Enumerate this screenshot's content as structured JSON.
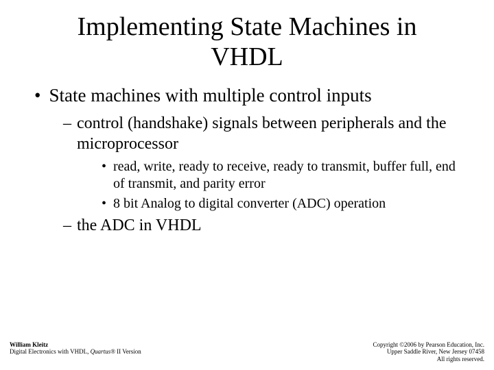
{
  "title": "Implementing State Machines in VHDL",
  "bullets": {
    "l1": "State machines with multiple control inputs",
    "l2a": "control (handshake) signals between peripherals and the microprocessor",
    "l3a": "read, write, ready to receive, ready to transmit, buffer full, end of transmit, and parity error",
    "l3b": "8 bit Analog to digital converter (ADC) operation",
    "l2b": "the ADC in VHDL"
  },
  "footer": {
    "author": "William Kleitz",
    "book_prefix": "Digital Electronics with VHDL, ",
    "book_ital": "Quartus®",
    "book_suffix": " II Version",
    "copyright_line1": "Copyright ©2006 by Pearson Education, Inc.",
    "copyright_line2": "Upper Saddle River, New Jersey 07458",
    "copyright_line3": "All rights reserved."
  }
}
